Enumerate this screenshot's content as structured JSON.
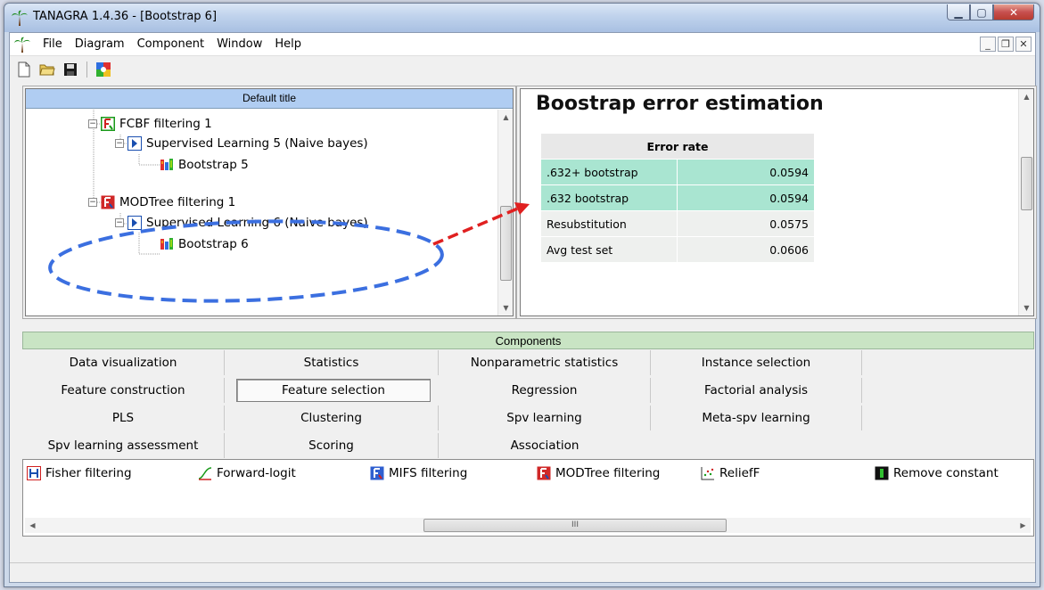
{
  "window": {
    "title": "TANAGRA 1.4.36 - [Bootstrap 6]"
  },
  "menu": {
    "items": [
      "File",
      "Diagram",
      "Component",
      "Window",
      "Help"
    ]
  },
  "diagram": {
    "title": "Default title",
    "nodes": [
      {
        "label": "FCBF filtering 1",
        "icon": "filter-green-icon"
      },
      {
        "label": "Supervised Learning 5 (Naive bayes)",
        "icon": "play-icon"
      },
      {
        "label": "Bootstrap 5",
        "icon": "bootstrap-icon"
      },
      {
        "label": "MODTree filtering 1",
        "icon": "filter-red-icon"
      },
      {
        "label": "Supervised Learning 6 (Naive bayes)",
        "icon": "play-icon"
      },
      {
        "label": "Bootstrap 6",
        "icon": "bootstrap-icon"
      }
    ]
  },
  "result": {
    "title": "Boostrap error estimation",
    "header": "Error rate",
    "rows": [
      {
        "label": ".632+ bootstrap",
        "value": "0.0594",
        "highlight": true
      },
      {
        "label": ".632 bootstrap",
        "value": "0.0594",
        "highlight": true
      },
      {
        "label": "Resubstitution",
        "value": "0.0575",
        "highlight": false
      },
      {
        "label": "Avg test set",
        "value": "0.0606",
        "highlight": false
      }
    ]
  },
  "components": {
    "title": "Components",
    "categories": [
      [
        "Data visualization",
        "Statistics",
        "Nonparametric statistics",
        "Instance selection"
      ],
      [
        "Feature construction",
        "Feature selection",
        "Regression",
        "Factorial analysis"
      ],
      [
        "PLS",
        "Clustering",
        "Spv learning",
        "Meta-spv learning"
      ],
      [
        "Spv learning assessment",
        "Scoring",
        "Association"
      ]
    ],
    "selected": "Feature selection",
    "items": [
      "Fisher filtering",
      "Forward-logit",
      "MIFS filtering",
      "MODTree filtering",
      "ReliefF",
      "Remove constant"
    ],
    "scroll_thumb": "III"
  },
  "colors": {
    "highlight": "#a9e5d1",
    "dash": "#3b6fe0",
    "arrow": "#e02020",
    "title_bg": "#b0cdf2",
    "comp_bg": "#c9e4c4"
  }
}
